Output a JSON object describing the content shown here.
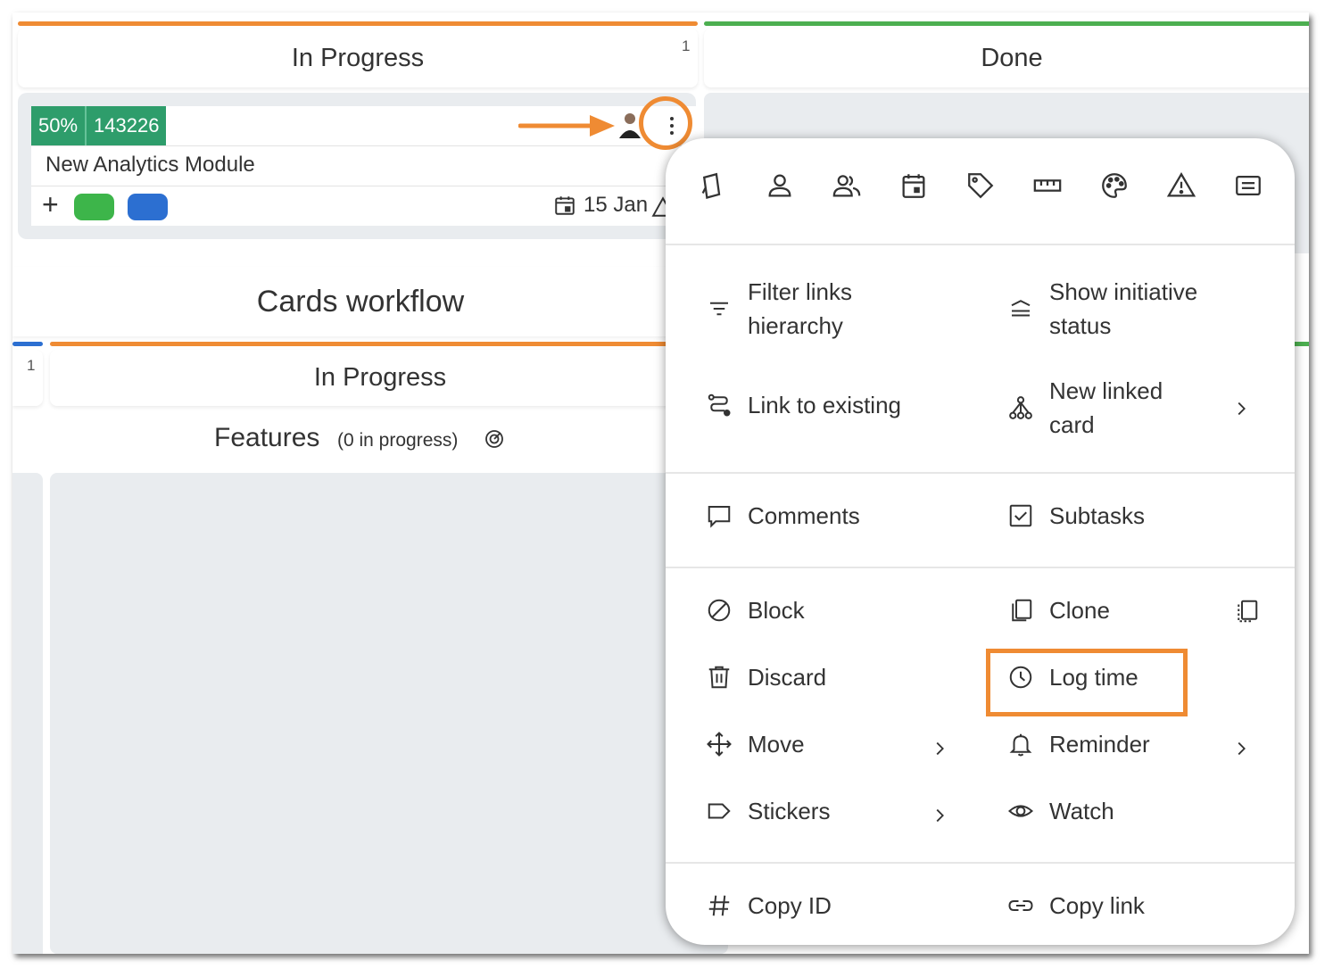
{
  "board": {
    "top_left_column": {
      "title": "In Progress",
      "count": "1",
      "bar_color": "#ef8b33"
    },
    "top_right_column": {
      "title": "Done",
      "bar_color": "#4caf50"
    },
    "card": {
      "progress": "50%",
      "id": "143226",
      "title": "New Analytics Module",
      "add_label": "+",
      "due_date": "15 Jan",
      "tag_colors": [
        "#3db54a",
        "#2c6fd1"
      ]
    },
    "workflow_title": "Cards workflow",
    "lower_left_count": "1",
    "lower_column": {
      "title": "In Progress",
      "bar_color": "#ef8b33"
    },
    "features": {
      "label": "Features",
      "sub": "(0 in progress)"
    }
  },
  "menu": {
    "top_icons": [
      "card-type-icon",
      "owner-icon",
      "co-owners-icon",
      "calendar-icon",
      "tag-icon",
      "size-icon",
      "color-palette-icon",
      "warning-icon",
      "template-icon"
    ],
    "section1": [
      {
        "label_line1": "Filter links",
        "label_line2": "hierarchy",
        "icon": "filter-icon"
      },
      {
        "label_line1": "Show initiative",
        "label_line2": "status",
        "icon": "initiative-status-icon"
      },
      {
        "label": "Link to existing",
        "icon": "link-path-icon"
      },
      {
        "label_line1": "New linked",
        "label_line2": "card",
        "icon": "hierarchy-icon"
      }
    ],
    "section2": [
      {
        "label": "Comments",
        "icon": "comment-icon"
      },
      {
        "label": "Subtasks",
        "icon": "checkbox-icon"
      }
    ],
    "section3": [
      {
        "label": "Block",
        "icon": "block-icon"
      },
      {
        "label": "Clone",
        "icon": "clone-icon"
      },
      {
        "label": "Discard",
        "icon": "trash-icon"
      },
      {
        "label": "Log time",
        "icon": "clock-icon"
      },
      {
        "label": "Move",
        "icon": "move-icon"
      },
      {
        "label": "Reminder",
        "icon": "bell-icon"
      },
      {
        "label": "Stickers",
        "icon": "sticker-icon"
      },
      {
        "label": "Watch",
        "icon": "eye-icon"
      }
    ],
    "section4": [
      {
        "label": "Copy ID",
        "icon": "hash-icon"
      },
      {
        "label": "Copy link",
        "icon": "link-icon"
      }
    ]
  },
  "annotation": {
    "color": "#ef8b33"
  }
}
